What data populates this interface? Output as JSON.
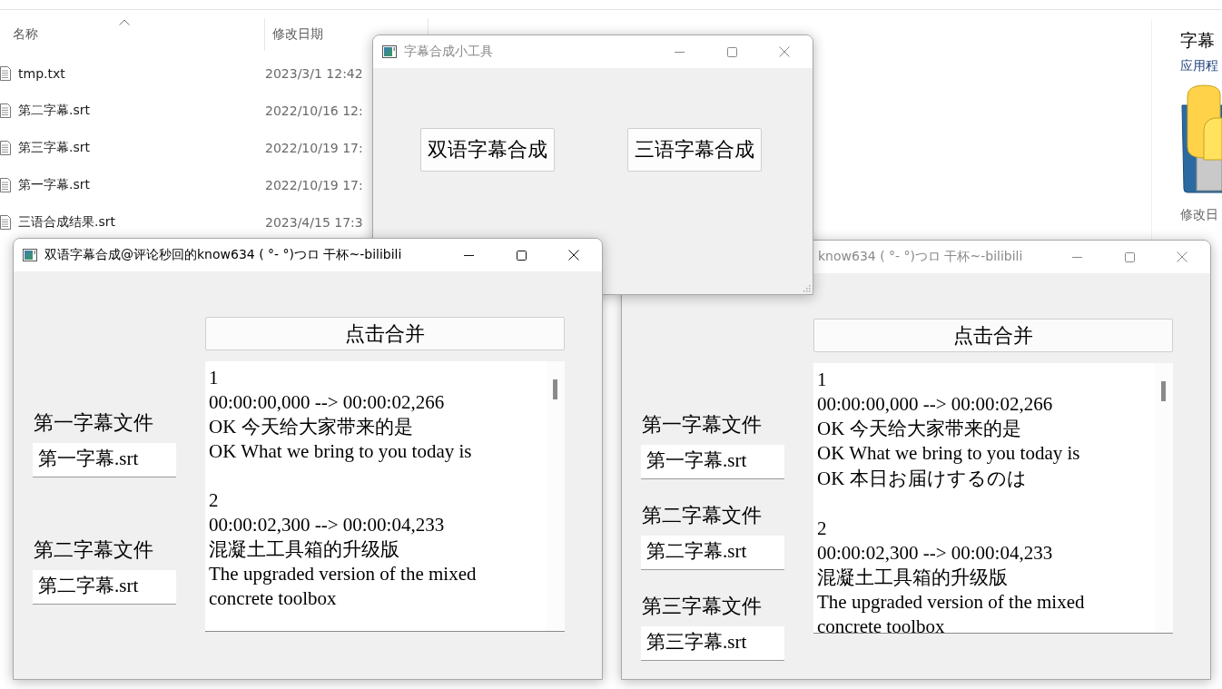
{
  "explorer": {
    "columns": [
      {
        "label": "名称",
        "sorted": true
      },
      {
        "label": "修改日期",
        "sorted": false
      }
    ],
    "rows": [
      {
        "name": "tmp.txt",
        "modified": "2023/3/1 12:42"
      },
      {
        "name": "第二字幕.srt",
        "modified": "2022/10/16 12:"
      },
      {
        "name": "第三字幕.srt",
        "modified": "2022/10/19 17:"
      },
      {
        "name": "第一字幕.srt",
        "modified": "2022/10/19 17:"
      },
      {
        "name": "三语合成结果.srt",
        "modified": "2023/4/15 17:3"
      }
    ],
    "details": {
      "title": "字幕",
      "type": "应用程",
      "fields": [
        "修改日"
      ]
    }
  },
  "trilingual_window": {
    "title": "know634 ( °- °)つロ 干杯~-bilibili",
    "active": false,
    "merge_button": "点击合并",
    "inputs": [
      {
        "label": "第一字幕文件",
        "value": "第一字幕.srt"
      },
      {
        "label": "第二字幕文件",
        "value": "第二字幕.srt"
      },
      {
        "label": "第三字幕文件",
        "value": "第三字幕.srt"
      }
    ],
    "output": [
      [
        "1",
        "00:00:00,000 --> 00:00:02,266",
        "OK 今天给大家带来的是",
        "OK What we bring to you today is",
        "OK 本日お届けするのは"
      ],
      [
        "2",
        "00:00:02,300 --> 00:00:04,233",
        "混凝土工具箱的升级版",
        "The upgraded version of the mixed concrete toolbox"
      ]
    ]
  },
  "launcher_window": {
    "title": "字幕合成小工具",
    "active": false,
    "buttons": [
      "双语字幕合成",
      "三语字幕合成"
    ]
  },
  "bilingual_window": {
    "title": "双语字幕合成@评论秒回的know634 ( °- °)つロ 干杯~-bilibili",
    "active": true,
    "merge_button": "点击合并",
    "inputs": [
      {
        "label": "第一字幕文件",
        "value": "第一字幕.srt"
      },
      {
        "label": "第二字幕文件",
        "value": "第二字幕.srt"
      }
    ],
    "output": [
      [
        "1",
        "00:00:00,000 --> 00:00:02,266",
        "OK 今天给大家带来的是",
        "OK What we bring to you today is"
      ],
      [
        "2",
        "00:00:02,300 --> 00:00:04,233",
        "混凝土工具箱的升级版",
        "The upgraded version of the mixed concrete toolbox"
      ]
    ]
  }
}
